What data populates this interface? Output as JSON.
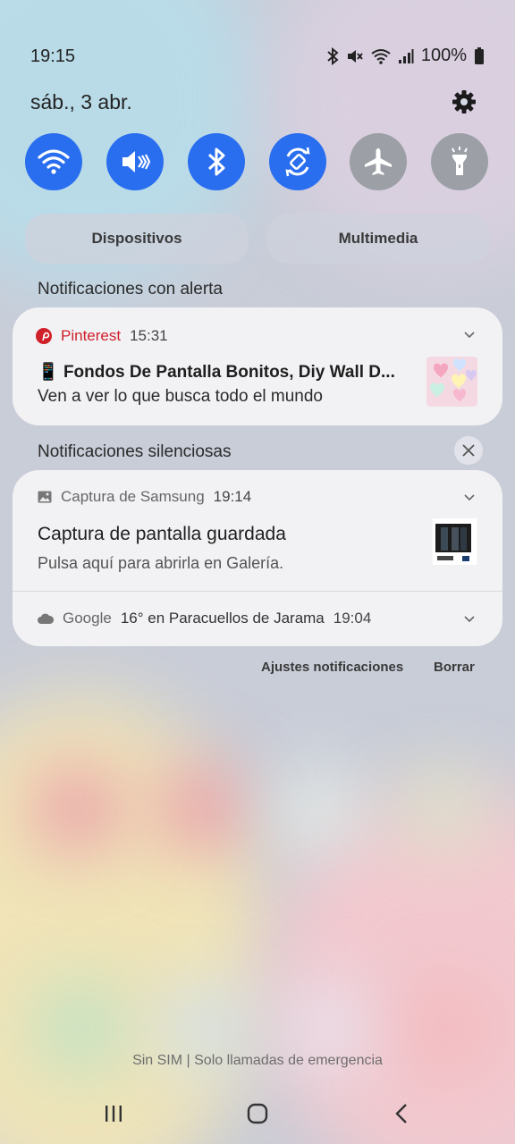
{
  "status_bar": {
    "time": "19:15",
    "battery": "100%",
    "icons": [
      "bluetooth-icon",
      "mute-icon",
      "wifi-icon",
      "signal-icon",
      "battery-icon"
    ]
  },
  "header": {
    "date": "sáb., 3 abr.",
    "settings_icon": "gear-icon"
  },
  "quick_settings": {
    "tiles": [
      {
        "name": "wifi",
        "icon": "wifi-icon",
        "state": "on"
      },
      {
        "name": "mute",
        "icon": "mute-icon",
        "state": "on"
      },
      {
        "name": "bluetooth",
        "icon": "bluetooth-icon",
        "state": "on"
      },
      {
        "name": "auto-rotate",
        "icon": "rotate-icon",
        "state": "on"
      },
      {
        "name": "airplane",
        "icon": "airplane-icon",
        "state": "off"
      },
      {
        "name": "flashlight",
        "icon": "flashlight-icon",
        "state": "off"
      }
    ],
    "devices_label": "Dispositivos",
    "media_label": "Multimedia"
  },
  "alert_section": {
    "label": "Notificaciones con alerta",
    "notification": {
      "app": "Pinterest",
      "time": "15:31",
      "title_emoji": "📱",
      "title": "Fondos De Pantalla Bonitos, Diy Wall D...",
      "body": "Ven a ver lo que busca todo el mundo"
    }
  },
  "silent_section": {
    "label": "Notificaciones silenciosas",
    "notifications": [
      {
        "app": "Captura de Samsung",
        "time": "19:14",
        "title": "Captura de pantalla guardada",
        "body": "Pulsa aquí para abrirla en Galería."
      },
      {
        "app": "Google",
        "summary": "16° en Paracuellos de Jarama",
        "time": "19:04"
      }
    ]
  },
  "actions": {
    "settings_label": "Ajustes notificaciones",
    "clear_label": "Borrar"
  },
  "footer": {
    "sim_status": "Sin SIM | Solo llamadas de emergencia"
  },
  "colors": {
    "tile_on": "#2a6ef0",
    "tile_off": "#9ca0a6",
    "pinterest": "#d0212a"
  }
}
